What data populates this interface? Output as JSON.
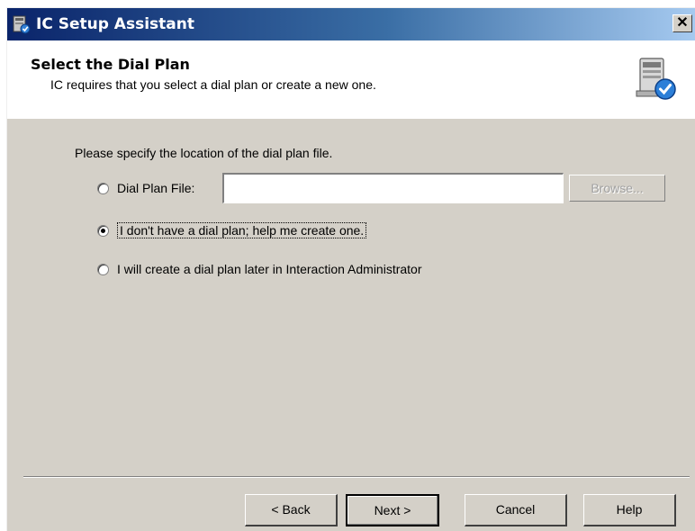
{
  "window": {
    "title": "IC Setup Assistant",
    "close_glyph": "✕"
  },
  "header": {
    "title": "Select the Dial Plan",
    "subtitle": "IC requires that you select a dial plan or create a new one.",
    "icon": "setup-wizard-icon"
  },
  "main": {
    "prompt": "Please specify the location of the dial plan file.",
    "options": [
      {
        "label": "Dial Plan File:",
        "checked": false
      },
      {
        "label": "I don't have a dial plan; help me create one.",
        "checked": true
      },
      {
        "label": "I will create a dial plan later in Interaction Administrator",
        "checked": false
      }
    ],
    "dial_plan_file_value": "",
    "browse_label": "Browse..."
  },
  "footer": {
    "back_label": "< Back",
    "next_label": "Next >",
    "cancel_label": "Cancel",
    "help_label": "Help"
  },
  "colors": {
    "titlebar_start": "#0a246a",
    "titlebar_end": "#a6caf0",
    "dialog_face": "#d4d0c8"
  }
}
